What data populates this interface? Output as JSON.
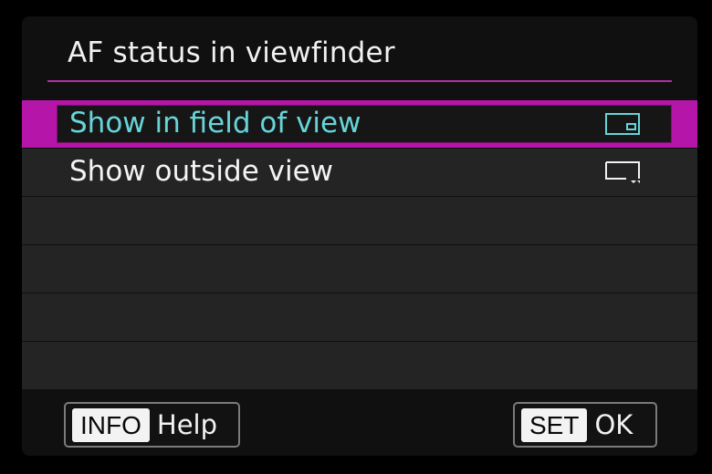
{
  "menu": {
    "title": "AF status in viewfinder",
    "options": [
      {
        "label": "Show in field of view",
        "icon": "frame-with-inner-indicator-icon",
        "selected": true
      },
      {
        "label": "Show outside view",
        "icon": "frame-with-outside-indicator-icon",
        "selected": false
      }
    ]
  },
  "footer": {
    "info": {
      "key": "INFO",
      "label": "Help"
    },
    "set": {
      "key": "SET",
      "label": "OK"
    }
  },
  "colors": {
    "highlight": "#b515a9",
    "selected_text": "#67d4d8",
    "background": "#101010"
  }
}
